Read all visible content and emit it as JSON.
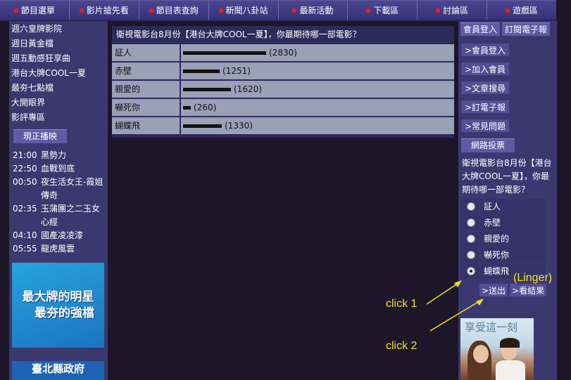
{
  "nav": {
    "items": [
      "節目選單",
      "影片搶先看",
      "節目表查詢",
      "新聞八卦站",
      "最新活動",
      "下載區",
      "討論區",
      "遊戲區"
    ]
  },
  "left": {
    "links": [
      "週六皇牌影院",
      "週日黃金檔",
      "週五動感狂享曲",
      "港台大牌COOL一夏",
      "最夯七點檔",
      "大開眼界",
      "影評專區"
    ],
    "now_playing_label": "現正播映",
    "schedule": [
      {
        "time": "21:00",
        "title": "黑勢力"
      },
      {
        "time": "22:50",
        "title": "血戰到底"
      },
      {
        "time": "00:50",
        "title": "夜生活女王-霞姐傳奇"
      },
      {
        "time": "02:35",
        "title": "玉蒲團之二玉女心經"
      },
      {
        "time": "04:10",
        "title": "國產凌凌漆"
      },
      {
        "time": "05:55",
        "title": "龍虎風雲"
      }
    ],
    "ad1_line1": "最大牌的明星",
    "ad1_line2": "最夯的強檔",
    "ad2_text": "臺北縣政府"
  },
  "results": {
    "question": "衛視電影台8月份【港台大牌COOL一夏】，你最期待哪一部電影？",
    "rows": [
      {
        "label": "証人",
        "count": "(2830)",
        "value": 2830
      },
      {
        "label": "赤壁",
        "count": "(1251)",
        "value": 1251
      },
      {
        "label": "親愛的",
        "count": "(1620)",
        "value": 1620
      },
      {
        "label": "嚇死你",
        "count": "(260)",
        "value": 260
      },
      {
        "label": "蝴蝶飛",
        "count": "(1330)",
        "value": 1330
      }
    ],
    "max_value": 2830
  },
  "right": {
    "tabs": [
      "會員登入",
      "訂閱電子報"
    ],
    "buttons": [
      ">會員登入",
      ">加入會員",
      ">文章搜尋",
      ">訂電子報",
      ">常見問題"
    ],
    "poll_tab": "網路投票",
    "poll_question": "衛視電影台8月份【港台大牌COOL一夏】，你最期待哪一部電影？",
    "options": [
      "証人",
      "赤壁",
      "親愛的",
      "嚇死你",
      "蝴蝶飛"
    ],
    "selected_index": 4,
    "submit_label": ">送出",
    "results_label": ">看結果",
    "ad3_text": "享受這一刻"
  },
  "annotations": {
    "linger": "(Linger)",
    "click1": "click 1",
    "click2": "click  2",
    "color": "#f5e11a"
  }
}
